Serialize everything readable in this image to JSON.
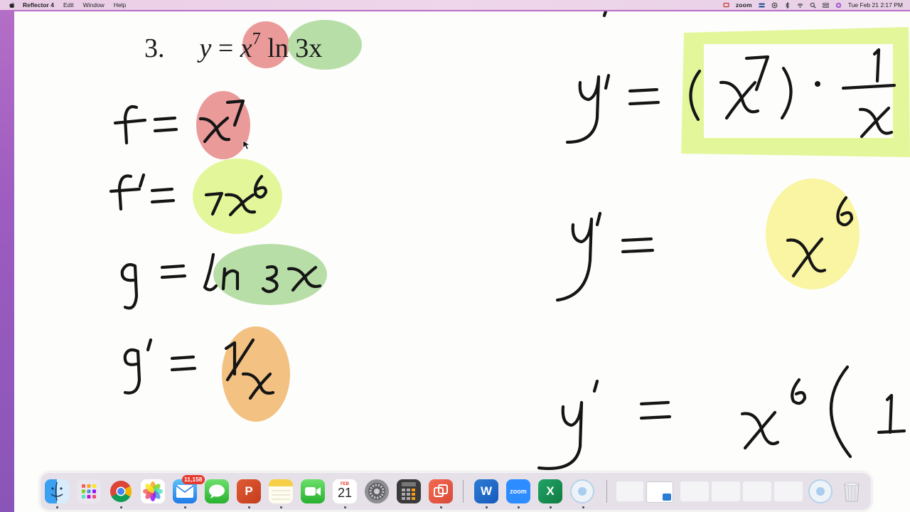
{
  "menubar": {
    "app_name": "Reflector 4",
    "menus": [
      "Edit",
      "Window",
      "Help"
    ],
    "zoom_label": "zoom",
    "clock": "Tue Feb 21  2:17 PM"
  },
  "problem": {
    "number": "3.",
    "lhs": "y",
    "equals": "=",
    "base": "x",
    "exponent": "7",
    "log_term": "ln 3x"
  },
  "handwriting": {
    "left": [
      "f = x⁷",
      "f' = 7x⁶",
      "g = ln 3x",
      "g' = 1/x"
    ],
    "right": [
      "y' = (x⁷) · 1/x",
      "y' = x⁶",
      "y' = x⁶( 1"
    ]
  },
  "highlight_colors": {
    "red": "#e99a99",
    "green": "#b8dea8",
    "yellow_green": "#e3f79a",
    "orange": "#f3c182",
    "yellow": "#f9f5a2"
  },
  "dock": {
    "apps": [
      {
        "name": "Finder",
        "icon": "finder-icon"
      },
      {
        "name": "Launchpad",
        "icon": "launchpad-icon"
      },
      {
        "name": "Chrome",
        "icon": "chrome-icon"
      },
      {
        "name": "Photos",
        "icon": "photos-icon"
      },
      {
        "name": "Mail",
        "icon": "mail-icon",
        "badge": "11,158"
      },
      {
        "name": "Messages",
        "icon": "messages-icon"
      },
      {
        "name": "PowerPoint",
        "icon": "powerpoint-icon",
        "label": "P"
      },
      {
        "name": "Notes",
        "icon": "notes-icon"
      },
      {
        "name": "FaceTime",
        "icon": "facetime-icon"
      },
      {
        "name": "Calendar",
        "icon": "calendar-icon",
        "month": "FEB",
        "day": "21"
      },
      {
        "name": "System Preferences",
        "icon": "settings-icon"
      },
      {
        "name": "Calculator",
        "icon": "calculator-icon"
      },
      {
        "name": "Reflector",
        "icon": "reflector-icon"
      },
      {
        "name": "Word",
        "icon": "word-icon",
        "label": "W"
      },
      {
        "name": "Zoom",
        "icon": "zoom-icon",
        "label": "zoom"
      },
      {
        "name": "Excel",
        "icon": "excel-icon",
        "label": "X"
      },
      {
        "name": "Screen Recorder",
        "icon": "record-icon"
      },
      {
        "name": "Trash",
        "icon": "trash-icon"
      }
    ]
  }
}
